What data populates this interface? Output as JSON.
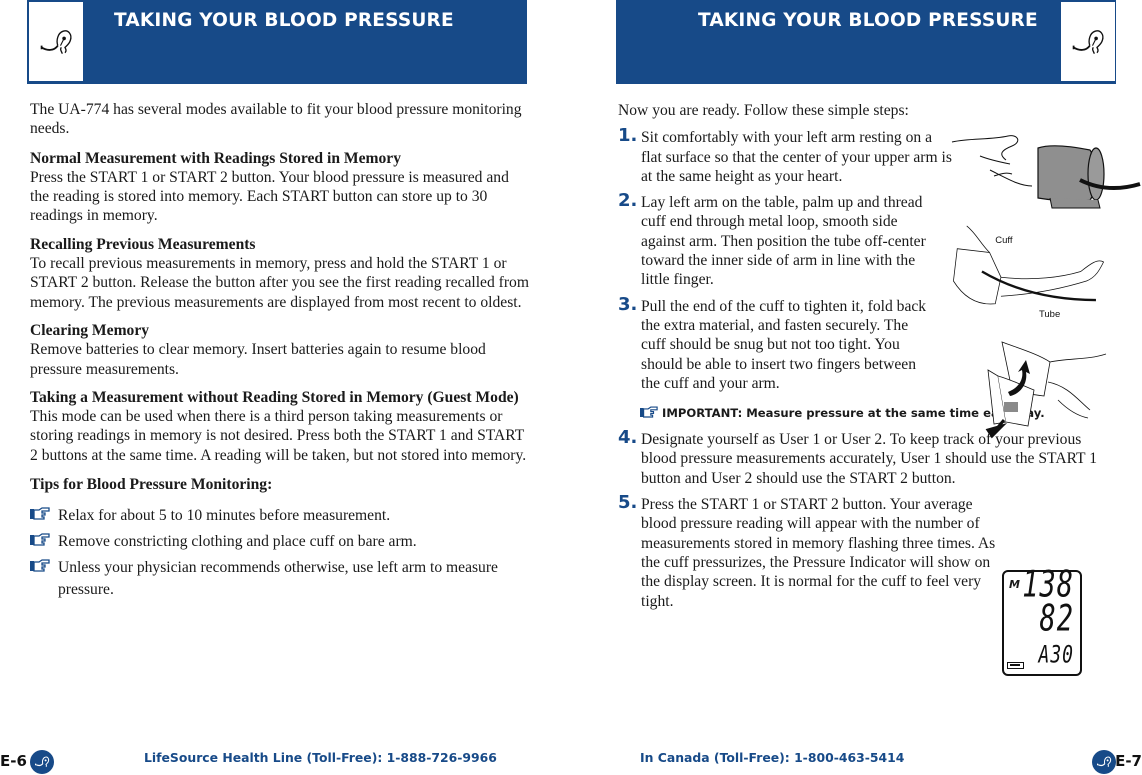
{
  "left_page": {
    "header": {
      "title": "TAKING YOUR BLOOD PRESSURE",
      "icon": "stethoscope-icon"
    },
    "intro": "The UA-774 has several modes available to fit your blood pressure monitoring needs.",
    "sections": [
      {
        "heading": "Normal Measurement with Readings Stored in Memory",
        "body": "Press the START 1 or START 2 button. Your blood pressure is measured and the reading is stored into memory. Each START button can store up to 30 readings in memory."
      },
      {
        "heading": "Recalling Previous Measurements",
        "body": "To recall previous measurements in memory, press and hold the START 1 or START 2 button. Release the button after you see the first reading recalled from memory. The previous measurements are displayed from most recent to oldest."
      },
      {
        "heading": "Clearing Memory",
        "body": "Remove batteries to clear memory. Insert batteries again to resume blood pressure measurements."
      },
      {
        "heading": "Taking a Measurement without Reading Stored in Memory (Guest Mode)",
        "body": "This mode can be used when there is a third person taking measurements or storing readings in memory is not desired. Press both the START 1 and START 2 buttons at the same time. A reading will be taken, but not stored into memory."
      }
    ],
    "tips": {
      "heading": "Tips for Blood Pressure Monitoring:",
      "items": [
        "Relax for about 5 to 10 minutes before measurement.",
        "Remove constricting clothing and place cuff on bare arm.",
        "Unless your physician recommends otherwise, use left arm to measure pressure."
      ]
    },
    "footer": {
      "page_number": "E-6",
      "text": "LifeSource Health Line (Toll-Free): 1-888-726-9966"
    }
  },
  "right_page": {
    "header": {
      "title": "TAKING YOUR BLOOD PRESSURE",
      "icon": "stethoscope-icon"
    },
    "intro": "Now you are ready. Follow these simple steps:",
    "steps": [
      {
        "number": "1.",
        "text": "Sit comfortably with your left arm resting on a flat surface so that the center of your upper arm is at the same height as your heart."
      },
      {
        "number": "2.",
        "text": "Lay left arm on the table, palm up and thread cuff end through metal loop, smooth side against arm. Then position the tube off-center toward the inner side of arm in line with the little finger."
      },
      {
        "number": "3.",
        "text": "Pull the end of the cuff to tighten it, fold back the extra material, and fasten securely. The cuff should be snug but not too tight. You should be able to insert two fingers between the cuff and your arm."
      },
      {
        "number": "4.",
        "text": "Designate yourself as User 1 or User 2. To keep track of your previous blood pressure measurements accurately, User 1 should use the START 1 button and User 2 should use the START 2 button."
      },
      {
        "number": "5.",
        "text": "Press the START 1 or START 2 button. Your average blood pressure reading will appear with the number of measurements stored in memory flashing three times. As the cuff pressurizes, the Pressure Indicator will show on the display screen. It is normal for the cuff to feel very tight."
      }
    ],
    "important": "IMPORTANT: Measure pressure at the same time each day.",
    "illustration_labels": {
      "cuff": "Cuff",
      "tube": "Tube"
    },
    "lcd": {
      "memory_indicator": "M",
      "systolic": "138",
      "diastolic": "82",
      "count": "A30"
    },
    "footer": {
      "page_number": "E-7",
      "text": "In Canada (Toll-Free): 1-800-463-5414"
    }
  },
  "colors": {
    "brand_blue": "#174a88"
  }
}
